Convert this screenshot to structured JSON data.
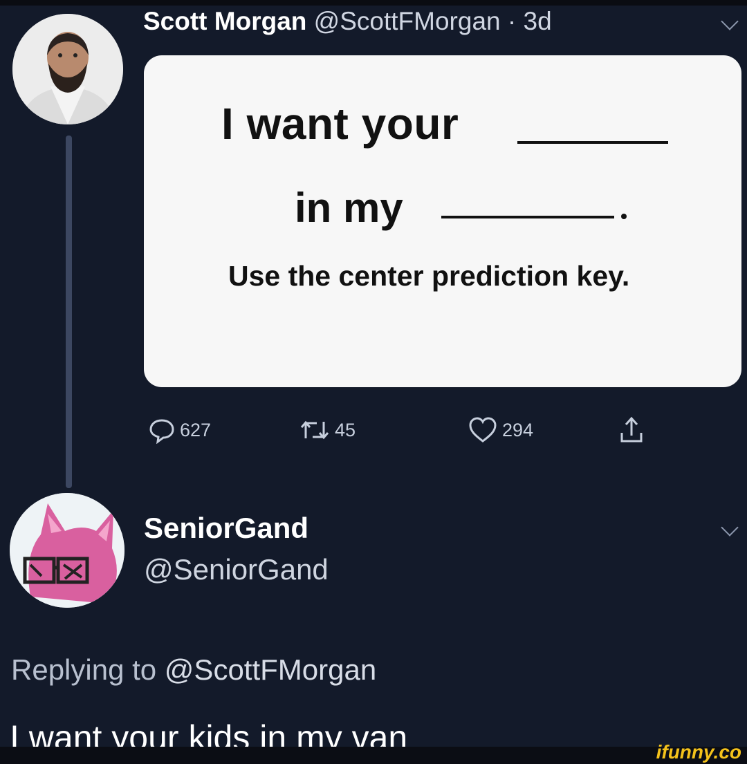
{
  "original_tweet": {
    "author_name": "Scott Morgan",
    "author_handle": "@ScottFMorgan",
    "separator": "·",
    "age": "3d",
    "card": {
      "line1": "I want your",
      "line2": "in my",
      "line3": "Use the center prediction key."
    },
    "actions": {
      "replies": "627",
      "retweets": "45",
      "likes": "294"
    }
  },
  "reply_tweet": {
    "author_name": "SeniorGand",
    "author_handle": "@SeniorGand",
    "replying_prefix": "Replying to",
    "replying_to": "@ScottFMorgan",
    "text": "I want your kids in my van"
  },
  "watermark": "ifunny.co",
  "colors": {
    "background": "#131a2a",
    "card": "#f7f7f7",
    "watermark": "#f4c21b"
  },
  "icons": [
    "chevron-down-icon",
    "reply-icon",
    "retweet-icon",
    "like-icon",
    "share-icon"
  ]
}
